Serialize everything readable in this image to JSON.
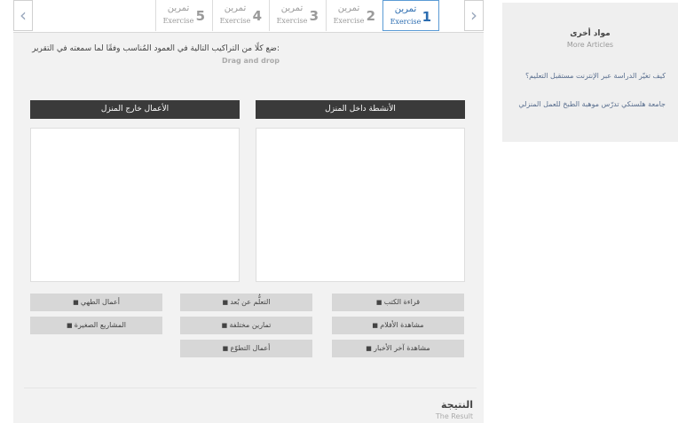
{
  "tabs": [
    {
      "num": "1",
      "ar": "تمرين",
      "en": "Exercise",
      "active": true
    },
    {
      "num": "2",
      "ar": "تمرين",
      "en": "Exercise",
      "active": false
    },
    {
      "num": "3",
      "ar": "تمرين",
      "en": "Exercise",
      "active": false
    },
    {
      "num": "4",
      "ar": "تمرين",
      "en": "Exercise",
      "active": false
    },
    {
      "num": "5",
      "ar": "تمرين",
      "en": "Exercise",
      "active": false
    }
  ],
  "nav": {
    "prev": "‹",
    "next": "›"
  },
  "instruction": {
    "ar": "ضع كلًا من التراكيب التالية في العمود المُناسب وفقًا لما سمعته في التقرير:",
    "en": "Drag and drop"
  },
  "columns": {
    "inside": "الأنشطة داخل المنزل",
    "outside": "الأعمال خارج المنزل"
  },
  "chips": [
    "قراءة الكتب",
    "التعلُّم عن بُعد",
    "أعمال الطهي",
    "مشاهدة الأفلام",
    "تمارين مختلفة",
    "المشاريع الصغيرة",
    "مشاهدة آخر الأخبار",
    "أعمال التطوّع"
  ],
  "result": {
    "ar": "النتيجة",
    "en": "The Result"
  },
  "sidebar": {
    "title_ar": "مواد أخرى",
    "title_en": "More Articles",
    "links": [
      "كيف تغيّر الدراسة عبر الإنترنت مستقبل التعليم؟",
      "جامعة هلسنكي تدرّس موهبة الطبخ للعمل المنزلي"
    ]
  }
}
